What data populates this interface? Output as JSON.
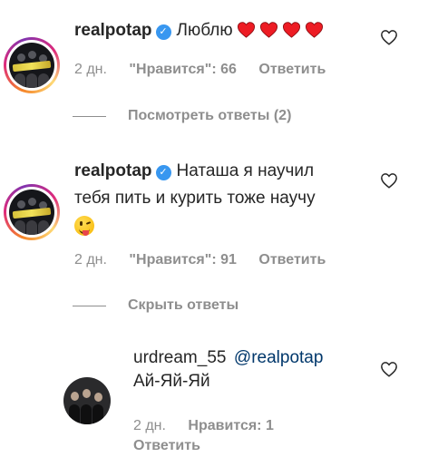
{
  "comments": [
    {
      "username": "realpotap",
      "text": "Люблю",
      "heart_count": 4,
      "age": "2 дн.",
      "likes_label": "\"Нравится\": 66",
      "reply_label": "Ответить",
      "replies_toggle": "Посмотреть ответы (2)"
    },
    {
      "username": "realpotap",
      "text_line1": "Наташа я научил",
      "text_line2": "тебя пить и курить тоже научу",
      "emoji": "winking-face-with-tongue-icon",
      "age": "2 дн.",
      "likes_label": "\"Нравится\": 91",
      "reply_label": "Ответить",
      "replies_toggle": "Скрыть ответы"
    }
  ],
  "reply": {
    "username": "urdream_55",
    "mention": "@realpotap",
    "text": "Ай-Яй-Яй",
    "age": "2 дн.",
    "likes_label": "Нравится: 1",
    "reply_label": "Ответить"
  },
  "colors": {
    "text": "#262626",
    "secondary": "#8e8e8e",
    "mention": "#00376b",
    "verified": "#3897f0",
    "heart": "#ed1c24"
  }
}
